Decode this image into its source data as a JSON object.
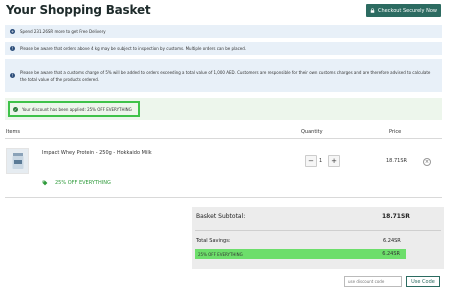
{
  "header": {
    "title": "Your Shopping Basket",
    "checkout_label": "Checkout Securely Now",
    "checkout_color": "#2c6b61"
  },
  "notices": [
    {
      "text": "Spend 231.26SR more to get Free Delivery"
    },
    {
      "text": "Please be aware that orders above 4 kg may be subject to inspection by customs. Multiple orders can be placed."
    },
    {
      "text": "Please be aware that a customs charge of 5% will be added to orders exceeding a total value of 1,000 AED. Customers are responsible for their own customs charges and are therefore advised to calculate the total value of the products ordered."
    }
  ],
  "discount_message": "Your discount has been applied: 25% OFF EVERYTHING",
  "table": {
    "col_items": "Items",
    "col_quantity": "Quantity",
    "col_price": "Price"
  },
  "item": {
    "name": "Impact Whey Protein - 250g - Hokkaido Milk",
    "quantity": "1",
    "minus_label": "−",
    "plus_label": "+",
    "price": "18.71SR",
    "remove_label": "×",
    "promo_label": "25% OFF EVERYTHING",
    "promo_color": "#2e9a3a"
  },
  "summary": {
    "subtotal_label": "Basket Subtotal:",
    "subtotal_value": "18.71SR",
    "savings_label": "Total Savings:",
    "savings_value": "6.24SR",
    "promo_line_label": "25% OFF EVERYTHING",
    "promo_line_value": "6.24SR",
    "highlight_color": "#6dde6b"
  },
  "discount_code": {
    "placeholder": "use discount code",
    "button_label": "Use Code"
  },
  "icons": [
    "lock-icon",
    "info-icon",
    "check-icon",
    "tag-icon",
    "remove-icon"
  ]
}
